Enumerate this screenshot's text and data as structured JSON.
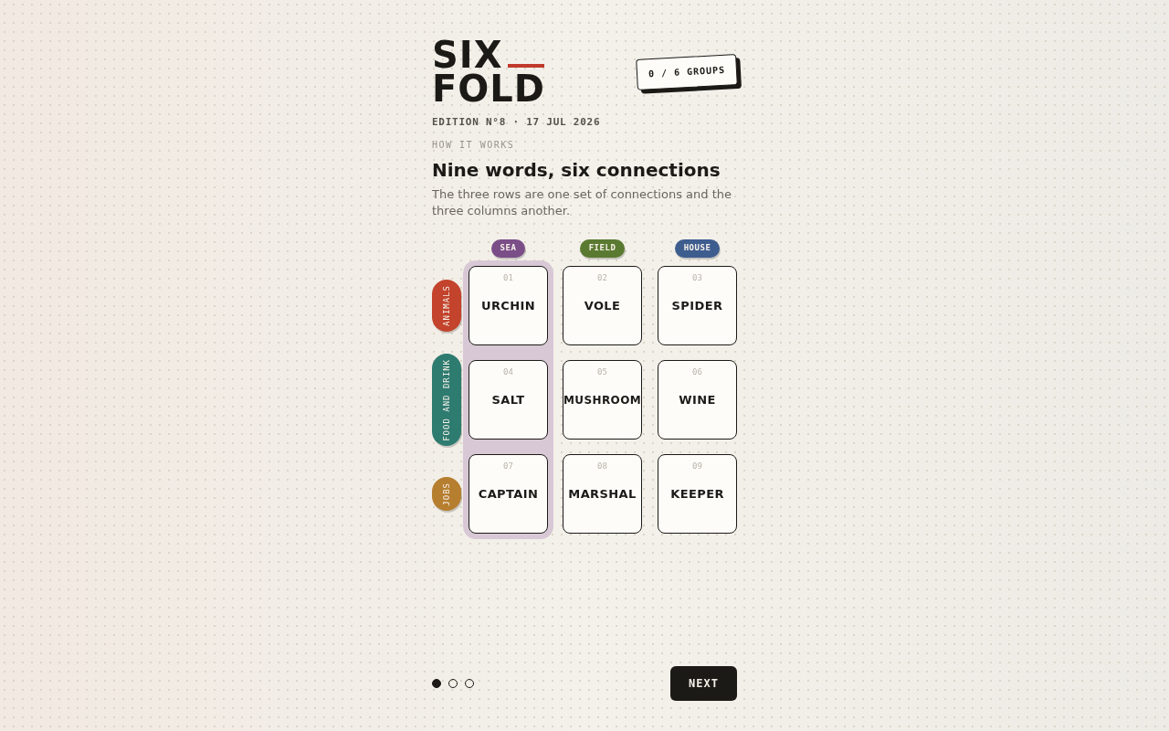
{
  "logo": {
    "line_1": "SIX",
    "line_2": "FOLD"
  },
  "score": "0 / 6 GROUPS",
  "edition": "EDITION N°8 · 17 JUL 2026",
  "section_label": "HOW IT WORKS",
  "heading": "Nine words, six connections",
  "description": "The three rows are one set of connections and the three columns another.",
  "columns": [
    {
      "label": "SEA",
      "color": "#7b4e88",
      "highlighted": true
    },
    {
      "label": "FIELD",
      "color": "#5b7a31",
      "highlighted": false
    },
    {
      "label": "HOUSE",
      "color": "#3e5d8f",
      "highlighted": false
    }
  ],
  "rows": [
    {
      "label": "ANIMALS",
      "color": "#c3432c",
      "cards": [
        {
          "number": "01",
          "word": "URCHIN"
        },
        {
          "number": "02",
          "word": "VOLE"
        },
        {
          "number": "03",
          "word": "SPIDER"
        }
      ]
    },
    {
      "label": "FOOD AND DRINK",
      "color": "#2e7b70",
      "cards": [
        {
          "number": "04",
          "word": "SALT"
        },
        {
          "number": "05",
          "word": "MUSHROOM"
        },
        {
          "number": "06",
          "word": "WINE"
        }
      ]
    },
    {
      "label": "JOBS",
      "color": "#b67e2f",
      "cards": [
        {
          "number": "07",
          "word": "CAPTAIN"
        },
        {
          "number": "08",
          "word": "MARSHAL"
        },
        {
          "number": "09",
          "word": "KEEPER"
        }
      ]
    }
  ],
  "pagination": [
    {
      "selected": true
    },
    {
      "selected": false
    },
    {
      "selected": false
    }
  ],
  "next_button": "NEXT"
}
